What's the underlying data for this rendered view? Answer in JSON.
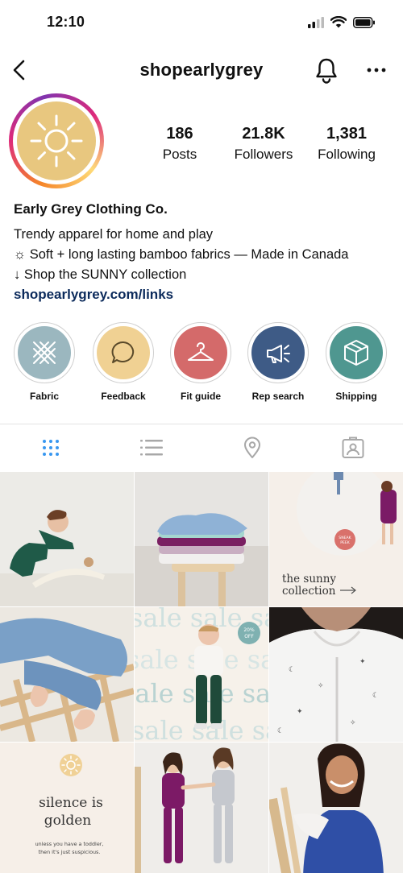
{
  "status": {
    "time": "12:10"
  },
  "header": {
    "username": "shopearlygrey"
  },
  "stats": [
    {
      "value": "186",
      "label": "Posts"
    },
    {
      "value": "21.8K",
      "label": "Followers"
    },
    {
      "value": "1,381",
      "label": "Following"
    }
  ],
  "bio": {
    "name": "Early Grey Clothing Co.",
    "lines": [
      "Trendy apparel for home and play",
      "☼ Soft + long lasting bamboo fabrics — Made in Canada",
      "↓ Shop the SUNNY collection"
    ],
    "link": "shopearlygrey.com/links"
  },
  "highlights": [
    {
      "label": "Fabric",
      "icon": "fabric-grid-icon",
      "color": "#9bb7bf"
    },
    {
      "label": "Feedback",
      "icon": "speech-bubble-icon",
      "color": "#f0d193"
    },
    {
      "label": "Fit guide",
      "icon": "hanger-icon",
      "color": "#d46a6a"
    },
    {
      "label": "Rep search",
      "icon": "megaphone-icon",
      "color": "#3e5b86"
    },
    {
      "label": "Shipping",
      "icon": "package-icon",
      "color": "#4f9790"
    }
  ],
  "tabs": [
    "grid-icon",
    "list-icon",
    "location-pin-icon",
    "tagged-icon"
  ],
  "posts": {
    "sunny_text": "the sunny collection",
    "sneak_badge": "SNEAK PEEK",
    "sale_word": "sale",
    "sale_badge": "20% OFF",
    "silence_title": "silence is golden",
    "silence_caption": "unless you have a toddler, then it's just suspicious."
  },
  "colors": {
    "accent": "#3897f0",
    "link": "#0b2a5b",
    "avatar": "#e8c77f"
  }
}
